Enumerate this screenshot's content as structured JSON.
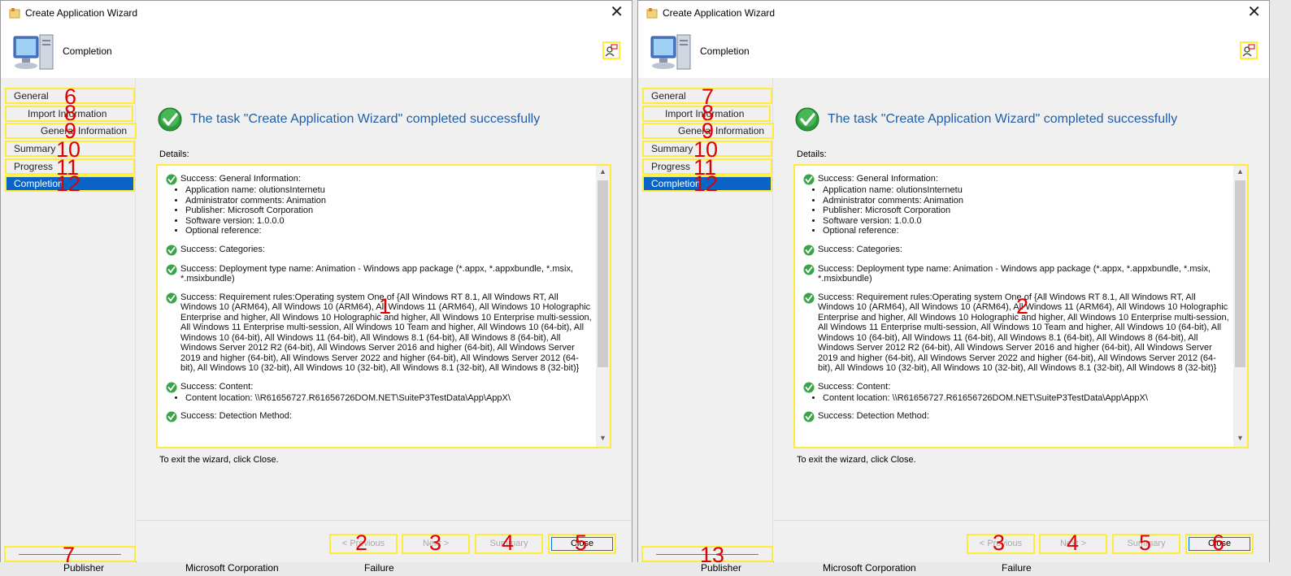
{
  "background": {
    "bottom_texts": [
      "Publisher",
      "Microsoft Corporation",
      "Failure"
    ]
  },
  "colors": {
    "accent": "#0a64c8",
    "highlight_border": "#ffeb3b",
    "marker": "#e00000",
    "title_blue": "#1f5fa8"
  },
  "windows": [
    {
      "title": "Create Application Wizard",
      "close_glyph": "✕",
      "header_title": "Completion",
      "nav": [
        {
          "label": "General",
          "marker": "6"
        },
        {
          "label": "Import Information",
          "marker": "8"
        },
        {
          "label": "General Information",
          "marker": "9"
        },
        {
          "label": "Summary",
          "marker": "10"
        },
        {
          "label": "Progress",
          "marker": "11"
        },
        {
          "label": "Completion",
          "marker": "12"
        }
      ],
      "sidebar_bottom_marker": "7",
      "success_title": "The task \"Create Application Wizard\" completed successfully",
      "details_label": "Details:",
      "details_marker": "1",
      "exit_text": "To exit the wizard, click Close.",
      "buttons": [
        {
          "label": "< Previous",
          "marker": "2"
        },
        {
          "label": "Next >",
          "marker": "3"
        },
        {
          "label": "Summary",
          "marker": "4"
        },
        {
          "label": "Close",
          "marker": "5"
        }
      ]
    },
    {
      "title": "Create Application Wizard",
      "close_glyph": "✕",
      "header_title": "Completion",
      "nav": [
        {
          "label": "General",
          "marker": "7"
        },
        {
          "label": "Import Information",
          "marker": "8"
        },
        {
          "label": "General Information",
          "marker": "9"
        },
        {
          "label": "Summary",
          "marker": "10"
        },
        {
          "label": "Progress",
          "marker": "11"
        },
        {
          "label": "Completion",
          "marker": "12"
        }
      ],
      "sidebar_bottom_marker": "13",
      "success_title": "The task \"Create Application Wizard\" completed successfully",
      "details_label": "Details:",
      "details_marker": "2",
      "exit_text": "To exit the wizard, click Close.",
      "buttons": [
        {
          "label": "< Previous",
          "marker": "3"
        },
        {
          "label": "Next >",
          "marker": "4"
        },
        {
          "label": "Summary",
          "marker": "5"
        },
        {
          "label": "Close",
          "marker": "6"
        }
      ]
    }
  ],
  "details": [
    {
      "head": "Success: General Information:",
      "items": [
        "Application name: olutionsInternetu",
        "Administrator comments: Animation",
        "Publisher: Microsoft Corporation",
        "Software version: 1.0.0.0",
        "Optional reference:"
      ]
    },
    {
      "head": "Success: Categories:",
      "items": []
    },
    {
      "head": "Success: Deployment type name: Animation - Windows app package (*.appx, *.appxbundle, *.msix, *.msixbundle)",
      "items": []
    },
    {
      "head": "Success: Requirement rules:Operating system One of {All Windows RT 8.1, All Windows RT, All Windows 10 (ARM64), All Windows 10 (ARM64), All Windows 11 (ARM64), All Windows 10 Holographic Enterprise and higher, All Windows 10 Holographic and higher, All Windows 10 Enterprise multi-session, All Windows 11 Enterprise multi-session, All Windows 10 Team and higher, All Windows 10 (64-bit), All Windows 10 (64-bit), All Windows 11 (64-bit), All Windows 8.1 (64-bit), All Windows 8 (64-bit), All Windows Server 2012 R2 (64-bit), All Windows Server 2016 and higher (64-bit), All Windows Server 2019 and higher (64-bit), All Windows Server 2022 and higher (64-bit), All Windows Server 2012 (64-bit), All Windows 10 (32-bit), All Windows 10 (32-bit), All Windows 8.1 (32-bit), All Windows 8 (32-bit)}",
      "items": []
    },
    {
      "head": "Success: Content:",
      "items": [
        "Content location: \\\\R61656727.R61656726DOM.NET\\SuiteP3TestData\\App\\AppX\\"
      ]
    },
    {
      "head": "Success: Detection Method:",
      "items": []
    }
  ]
}
